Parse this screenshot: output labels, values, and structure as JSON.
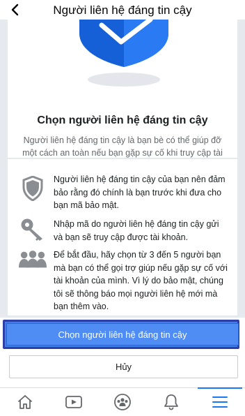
{
  "header": {
    "title": "Người liên hệ đáng tin cậy"
  },
  "intro": {
    "title": "Chọn người liên hệ đáng tin cậy",
    "description": "Người liên hệ đáng tin cậy là bạn bè có thể giúp đỡ một cách an toàn nếu bạn gặp sự cố khi truy cập tài khoản."
  },
  "info_items": [
    {
      "icon": "shield-icon",
      "text": "Người liên hệ đáng tin cậy của bạn nên đảm bảo rằng đó chính là bạn trước khi đưa cho bạn mã bảo mật."
    },
    {
      "icon": "key-icon",
      "text": "Nhập mã do người liên hệ đáng tin cậy gửi và bạn sẽ truy cập được tài khoản."
    },
    {
      "icon": "people-icon",
      "text": "Để bắt đầu, hãy chọn từ 3 đến 5 người bạn mà bạn có thể gọi trợ giúp nếu gặp sự cố với tài khoản của mình. Vì lý do bảo mật, chúng tôi sẽ thông báo mọi người liên hệ mới mà bạn thêm vào."
    }
  ],
  "actions": {
    "primary_label": "Chọn người liên hệ đáng tin cậy",
    "cancel_label": "Hủy"
  },
  "colors": {
    "primary": "#4f8cf3",
    "shield": "#1877f2",
    "nav_active": "#1877f2"
  },
  "bottom_nav": [
    {
      "icon": "home-icon"
    },
    {
      "icon": "video-icon"
    },
    {
      "icon": "groups-icon"
    },
    {
      "icon": "bell-icon"
    },
    {
      "icon": "menu-icon",
      "active": true
    }
  ]
}
